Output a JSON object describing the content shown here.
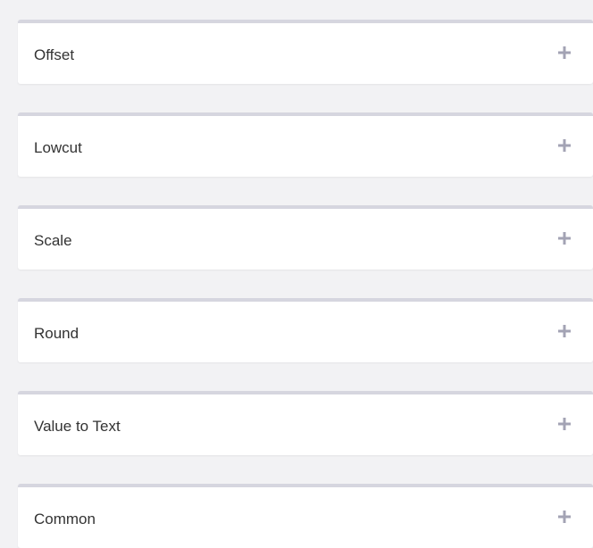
{
  "panels": [
    {
      "title": "Offset",
      "toggle_icon": "plus-icon"
    },
    {
      "title": "Lowcut",
      "toggle_icon": "plus-icon"
    },
    {
      "title": "Scale",
      "toggle_icon": "plus-icon"
    },
    {
      "title": "Round",
      "toggle_icon": "plus-icon"
    },
    {
      "title": "Value to Text",
      "toggle_icon": "plus-icon"
    },
    {
      "title": "Common",
      "toggle_icon": "plus-icon"
    }
  ],
  "colors": {
    "background": "#f2f2f4",
    "panel": "#ffffff",
    "panel_top_border": "#d6d6df",
    "title_text": "#333333",
    "icon": "#a3a3b4"
  }
}
